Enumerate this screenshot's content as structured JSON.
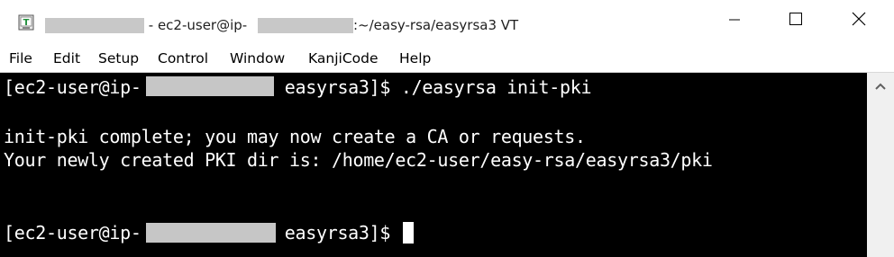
{
  "window": {
    "title_host_suffix": " - ec2-user@ip-",
    "title_path": ":~/easy-rsa/easyrsa3 VT",
    "minimize_label": "minimize",
    "maximize_label": "maximize",
    "close_label": "close"
  },
  "menu": {
    "items": [
      "File",
      "Edit",
      "Setup",
      "Control",
      "Window",
      "KanjiCode",
      "Help"
    ]
  },
  "terminal": {
    "lines": [
      {
        "prefix": "[ec2-user@ip-",
        "suffix": " easyrsa3]$ ./easyrsa init-pki"
      },
      {
        "text": "init-pki complete; you may now create a CA or requests."
      },
      {
        "text": "Your newly created PKI dir is: /home/ec2-user/easy-rsa/easyrsa3/pki"
      },
      {
        "prefix": "[ec2-user@ip-",
        "suffix": " easyrsa3]$"
      }
    ]
  },
  "colors": {
    "terminal_bg": "#000000",
    "terminal_fg": "#ffffff",
    "redaction": "#c8c8c8",
    "app_icon_green": "#1f8f3a"
  },
  "icons": {
    "app": "teraterm-icon",
    "minimize": "minimize-icon",
    "maximize": "maximize-icon",
    "close": "close-icon",
    "scroll_up": "scroll-up-arrow-icon"
  }
}
